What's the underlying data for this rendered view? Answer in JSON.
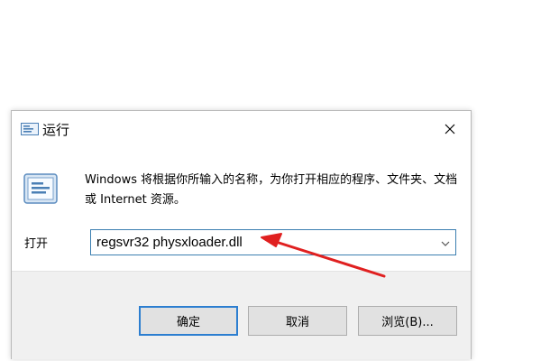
{
  "window": {
    "title": "运行",
    "icon": "run-icon",
    "close_icon": "close-icon"
  },
  "description": "Windows 将根据你所输入的名称，为你打开相应的程序、文件夹、文档或 Internet 资源。",
  "open_field": {
    "label": "打开",
    "value": "regsvr32 physxloader.dll",
    "dropdown_icon": "chevron-down-icon"
  },
  "buttons": {
    "ok": "确定",
    "cancel": "取消",
    "browse": "浏览(B)..."
  },
  "colors": {
    "focus_border": "#3c7fb1",
    "default_button_border": "#2c7ed0",
    "annotation_arrow": "#e02020",
    "footer_bg": "#f0f0f0"
  }
}
